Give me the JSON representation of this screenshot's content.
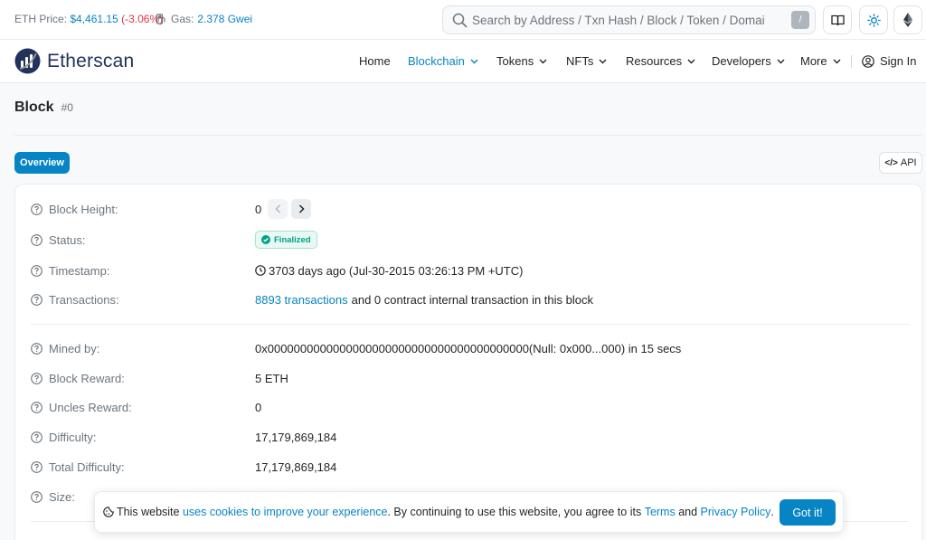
{
  "topbar": {
    "eth_price_label": "ETH Price:",
    "eth_price_value": "$4,461.15",
    "eth_price_change": "(-3.06%)",
    "gas_label": "Gas:",
    "gas_value": "2.378 Gwei",
    "search_placeholder": "Search by Address / Txn Hash / Block / Token / Domai",
    "search_shortcut": "/"
  },
  "nav": {
    "logo_text": "Etherscan",
    "items": [
      {
        "label": "Home"
      },
      {
        "label": "Blockchain"
      },
      {
        "label": "Tokens"
      },
      {
        "label": "NFTs"
      },
      {
        "label": "Resources"
      },
      {
        "label": "Developers"
      },
      {
        "label": "More"
      }
    ],
    "sign_in": "Sign In"
  },
  "page": {
    "title": "Block",
    "block_number": "#0",
    "tab_overview": "Overview",
    "api_label": "API"
  },
  "details": {
    "block_height_label": "Block Height:",
    "block_height_value": "0",
    "status_label": "Status:",
    "status_value": "Finalized",
    "timestamp_label": "Timestamp:",
    "timestamp_value": "3703 days ago (Jul-30-2015 03:26:13 PM +UTC)",
    "transactions_label": "Transactions:",
    "transactions_link": "8893 transactions",
    "transactions_rest": "and 0 contract internal transaction in this block",
    "mined_by_label": "Mined by:",
    "mined_by_value": "0x0000000000000000000000000000000000000000(Null: 0x000...000) in 15 secs",
    "block_reward_label": "Block Reward:",
    "block_reward_value": "5 ETH",
    "uncles_reward_label": "Uncles Reward:",
    "uncles_reward_value": "0",
    "difficulty_label": "Difficulty:",
    "difficulty_value": "17,179,869,184",
    "total_difficulty_label": "Total Difficulty:",
    "total_difficulty_value": "17,179,869,184",
    "size_label": "Size:"
  },
  "cookie": {
    "text_1": "This website",
    "link_1": "uses cookies to improve your experience",
    "text_2": ". By continuing to use this website, you agree to its",
    "link_terms": "Terms",
    "text_3": "and",
    "link_privacy": "Privacy Policy",
    "text_4": ".",
    "button": "Got it!"
  },
  "colors": {
    "accent": "#0784c3",
    "negative": "#dc3545",
    "success": "#00a186"
  }
}
